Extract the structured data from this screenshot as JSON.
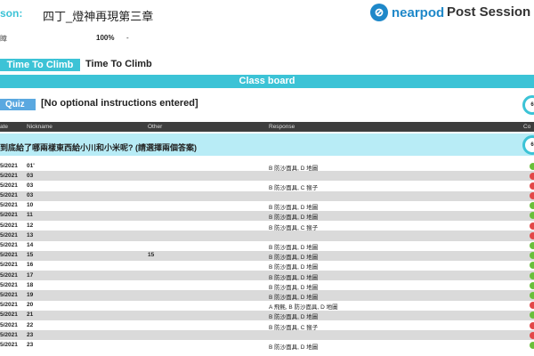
{
  "header": {
    "lesson_label": "son:",
    "lesson_title": "四丁_燈神再現第三章",
    "logo_text": "nearpod",
    "report_title": "Post Session Rep"
  },
  "stats": {
    "label": "瞕",
    "percent": "100%",
    "dash": "-"
  },
  "time_to_climb": {
    "badge": "Time To Climb",
    "text": "Time To Climb"
  },
  "classboard": {
    "label": "Class board"
  },
  "quiz": {
    "badge": "Quiz",
    "instructions": "[No optional instructions entered]",
    "score_ring": "6"
  },
  "table": {
    "headers": {
      "date": "ate",
      "nickname": "Nickname",
      "other": "Other",
      "response": "Response",
      "correct": "Co"
    }
  },
  "question": {
    "text": "到底給了哪兩樣東西給小川和小米呢? (請選擇兩個答案)",
    "score_ring": "6"
  },
  "colors": {
    "accent": "#3cc3d6",
    "quiz": "#5aa8e0",
    "correct": "#6abf3a",
    "incorrect": "#e34848"
  },
  "rows": [
    {
      "date": "5/2021",
      "nickname": "01'",
      "other": "",
      "response": "B 防沙面具, D 地圖",
      "status": "correct"
    },
    {
      "date": "5/2021",
      "nickname": "03",
      "other": "",
      "response": "",
      "status": "incorrect"
    },
    {
      "date": "5/2021",
      "nickname": "03",
      "other": "",
      "response": "B 防沙面具, C 猴子",
      "status": "incorrect"
    },
    {
      "date": "5/2021",
      "nickname": "03",
      "other": "",
      "response": "",
      "status": "incorrect"
    },
    {
      "date": "5/2021",
      "nickname": "10",
      "other": "",
      "response": "B 防沙面具, D 地圖",
      "status": "correct"
    },
    {
      "date": "5/2021",
      "nickname": "11",
      "other": "",
      "response": "B 防沙面具, D 地圖",
      "status": "correct"
    },
    {
      "date": "5/2021",
      "nickname": "12",
      "other": "",
      "response": "B 防沙面具, C 猴子",
      "status": "incorrect"
    },
    {
      "date": "5/2021",
      "nickname": "13",
      "other": "",
      "response": "",
      "status": "incorrect"
    },
    {
      "date": "5/2021",
      "nickname": "14",
      "other": "",
      "response": "B 防沙面具, D 地圖",
      "status": "correct"
    },
    {
      "date": "5/2021",
      "nickname": "15",
      "other": "15",
      "response": "B 防沙面具, D 地圖",
      "status": "correct"
    },
    {
      "date": "5/2021",
      "nickname": "16",
      "other": "",
      "response": "B 防沙面具, D 地圖",
      "status": "correct"
    },
    {
      "date": "5/2021",
      "nickname": "17",
      "other": "",
      "response": "B 防沙面具, D 地圖",
      "status": "correct"
    },
    {
      "date": "5/2021",
      "nickname": "18",
      "other": "",
      "response": "B 防沙面具, D 地圖",
      "status": "correct"
    },
    {
      "date": "5/2021",
      "nickname": "19",
      "other": "",
      "response": "B 防沙面具, D 地圖",
      "status": "correct"
    },
    {
      "date": "5/2021",
      "nickname": "20",
      "other": "",
      "response": "A 飛氈, B 防沙面具, D 地圖",
      "status": "incorrect"
    },
    {
      "date": "5/2021",
      "nickname": "21",
      "other": "",
      "response": "B 防沙面具, D 地圖",
      "status": "correct"
    },
    {
      "date": "5/2021",
      "nickname": "22",
      "other": "",
      "response": "B 防沙面具, C 猴子",
      "status": "incorrect"
    },
    {
      "date": "5/2021",
      "nickname": "23",
      "other": "",
      "response": "",
      "status": "incorrect"
    },
    {
      "date": "5/2021",
      "nickname": "23",
      "other": "",
      "response": "B 防沙面具, D 地圖",
      "status": "correct"
    }
  ]
}
